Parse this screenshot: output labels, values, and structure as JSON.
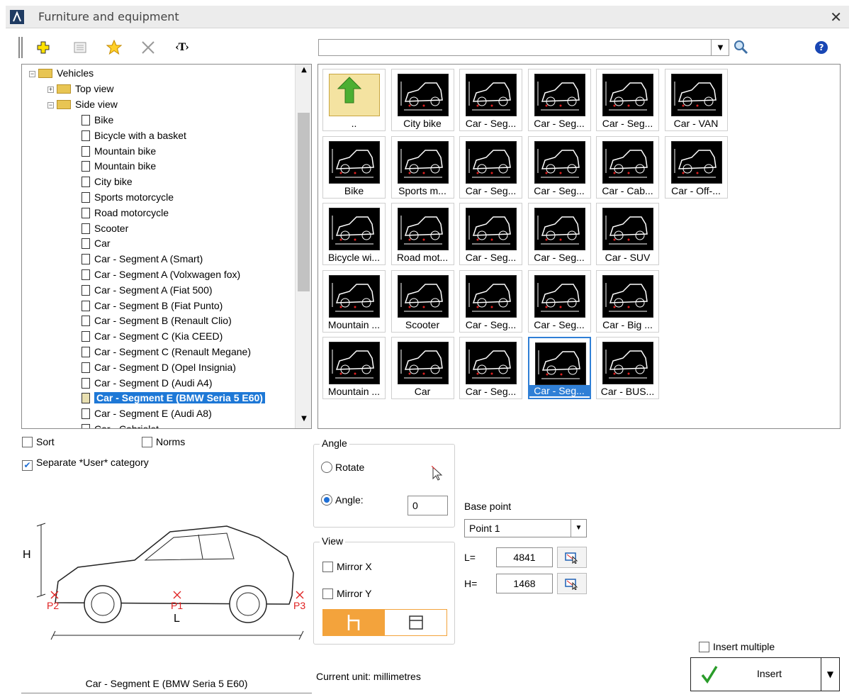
{
  "window": {
    "title": "Furniture and equipment",
    "close_glyph": "✕"
  },
  "toolbar": {
    "icons": [
      "add-icon",
      "properties-icon",
      "favorite-icon",
      "delete-icon",
      "text-tag-icon"
    ],
    "text_tag_label": "‹T›",
    "search_placeholder": "",
    "help_glyph": "?"
  },
  "tree": {
    "root": "Vehicles",
    "top_view": "Top view",
    "side_view": "Side view",
    "items": [
      "Bike",
      "Bicycle with a basket",
      "Mountain bike",
      "Mountain bike",
      "City bike",
      "Sports motorcycle",
      "Road motorcycle",
      "Scooter",
      "Car",
      "Car - Segment A (Smart)",
      "Car - Segment A (Volxwagen fox)",
      "Car - Segment A (Fiat 500)",
      "Car - Segment B (Fiat Punto)",
      "Car - Segment B (Renault Clio)",
      "Car - Segment C (Kia CEED)",
      "Car - Segment C (Renault Megane)",
      "Car - Segment D (Opel Insignia)",
      "Car - Segment D (Audi A4)",
      "Car - Segment E (BMW Seria 5 E60)",
      "Car - Segment E (Audi A8)",
      "Car - Cabriolet"
    ],
    "selected_index": 18
  },
  "grid": {
    "tiles": [
      [
        {
          "label": "..",
          "kind": "up"
        },
        {
          "label": "City bike"
        },
        {
          "label": "Car - Seg..."
        },
        {
          "label": "Car - Seg..."
        },
        {
          "label": "Car - Seg..."
        },
        {
          "label": "Car - VAN"
        }
      ],
      [
        {
          "label": "Bike"
        },
        {
          "label": "Sports m..."
        },
        {
          "label": "Car - Seg..."
        },
        {
          "label": "Car - Seg..."
        },
        {
          "label": "Car - Cab..."
        },
        {
          "label": "Car - Off-..."
        }
      ],
      [
        {
          "label": "Bicycle wi..."
        },
        {
          "label": "Road mot..."
        },
        {
          "label": "Car - Seg..."
        },
        {
          "label": "Car - Seg..."
        },
        {
          "label": "Car - SUV"
        }
      ],
      [
        {
          "label": "Mountain ..."
        },
        {
          "label": "Scooter"
        },
        {
          "label": "Car - Seg..."
        },
        {
          "label": "Car - Seg..."
        },
        {
          "label": "Car - Big ..."
        }
      ],
      [
        {
          "label": "Mountain ..."
        },
        {
          "label": "Car"
        },
        {
          "label": "Car - Seg..."
        },
        {
          "label": "Car - Seg...",
          "selected": true
        },
        {
          "label": "Car - BUS..."
        }
      ]
    ]
  },
  "options": {
    "sort": {
      "label": "Sort",
      "checked": false
    },
    "norms": {
      "label": "Norms",
      "checked": false
    },
    "separate_user": {
      "label": "Separate *User* category",
      "checked": true
    }
  },
  "preview": {
    "caption": "Car - Segment E (BMW Seria 5 E60)",
    "labels": {
      "h": "H",
      "l": "L",
      "p1": "P1",
      "p2": "P2",
      "p3": "P3"
    }
  },
  "angle_group": {
    "title": "Angle",
    "rotate_label": "Rotate",
    "angle_label": "Angle:",
    "angle_value": "0",
    "selected": "angle"
  },
  "view_group": {
    "title": "View",
    "mirror_x": "Mirror X",
    "mirror_y": "Mirror Y",
    "active_view": "side"
  },
  "base_point": {
    "label": "Base point",
    "value": "Point 1",
    "l_label": "L=",
    "l_value": "4841",
    "h_label": "H=",
    "h_value": "1468"
  },
  "footer": {
    "unit_text": "Current unit: millimetres",
    "insert_multiple": "Insert multiple",
    "insert_label": "Insert"
  },
  "colors": {
    "accent": "#1e78d6",
    "orange": "#f3a33c",
    "marker": "#e02020"
  }
}
